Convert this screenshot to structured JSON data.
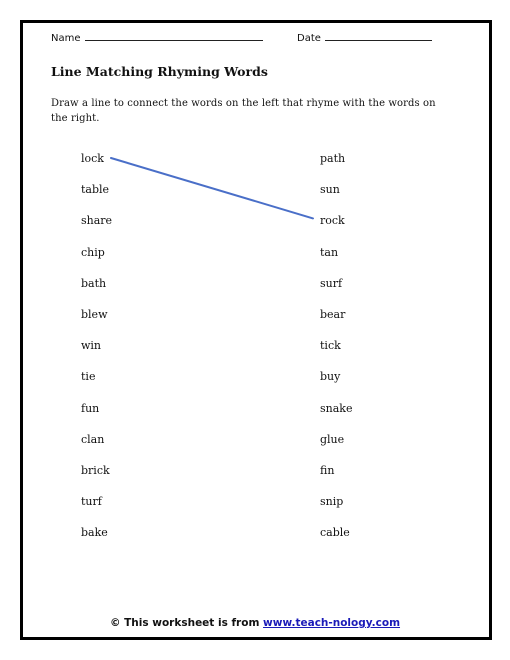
{
  "header": {
    "name_label": "Name",
    "date_label": "Date"
  },
  "title": "Line Matching Rhyming Words",
  "instructions": "Draw a line to connect the words on the left that rhyme with the words on the right.",
  "left_words": [
    "lock",
    "table",
    "share",
    "chip",
    "bath",
    "blew",
    "win",
    "tie",
    "fun",
    "clan",
    "brick",
    "turf",
    "bake"
  ],
  "right_words": [
    "path",
    "sun",
    "rock",
    "tan",
    "surf",
    "bear",
    "tick",
    "buy",
    "snake",
    "glue",
    "fin",
    "snip",
    "cable"
  ],
  "drawn_connections": [
    {
      "from_left": "lock",
      "to_right": "rock",
      "color": "#4a6fc8"
    }
  ],
  "footer": {
    "text": "© This worksheet is from ",
    "link_text": "www.teach-nology.com"
  }
}
